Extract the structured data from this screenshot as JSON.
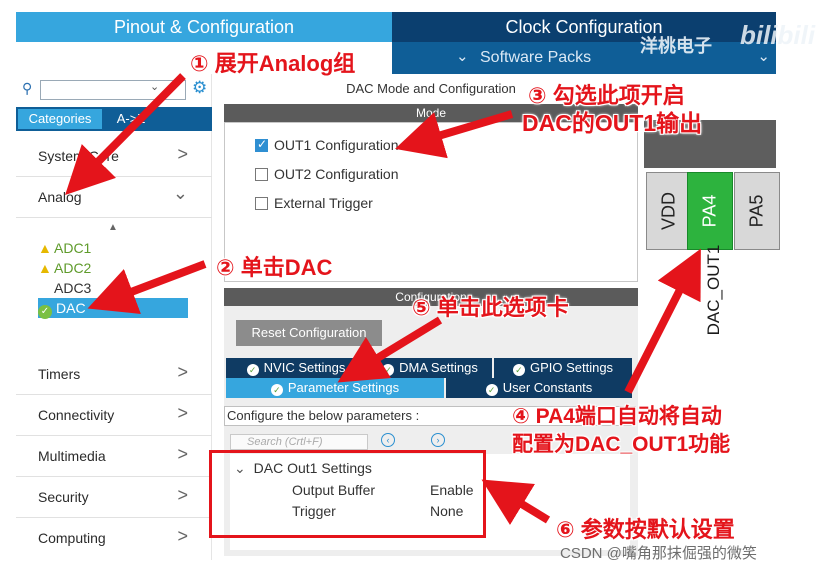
{
  "header": {
    "tab_pinout": "Pinout & Configuration",
    "tab_clock": "Clock Configuration",
    "software_packs": "Software Packs",
    "chevron_left": "⌄",
    "chevron_right": "⌄",
    "watermark_cn": "洋桃电子",
    "watermark_logo": "bilibili"
  },
  "left": {
    "search_placeholder": "",
    "tabs": {
      "categories": "Categories",
      "az": "A->Z"
    },
    "categories": [
      {
        "label": "System Core",
        "chevron": ">"
      },
      {
        "label": "Analog",
        "chevron": "⌄"
      },
      {
        "label": "Timers",
        "chevron": ">"
      },
      {
        "label": "Connectivity",
        "chevron": ">"
      },
      {
        "label": "Multimedia",
        "chevron": ">"
      },
      {
        "label": "Security",
        "chevron": ">"
      },
      {
        "label": "Computing",
        "chevron": ">"
      }
    ],
    "analog_items": [
      {
        "label": "ADC1",
        "status": "warning"
      },
      {
        "label": "ADC2",
        "status": "warning"
      },
      {
        "label": "ADC3",
        "status": "none"
      },
      {
        "label": "DAC",
        "status": "selected-ok"
      }
    ]
  },
  "mode": {
    "title": "DAC Mode and Configuration",
    "bar": "Mode",
    "options": [
      {
        "label": "OUT1 Configuration",
        "checked": true
      },
      {
        "label": "OUT2 Configuration",
        "checked": false
      },
      {
        "label": "External Trigger",
        "checked": false
      }
    ]
  },
  "config": {
    "bar": "Configuration",
    "reset_label": "Reset Configuration",
    "tabs": {
      "nvic": "NVIC Settings",
      "dma": "DMA Settings",
      "gpio": "GPIO Settings",
      "param": "Parameter Settings",
      "user": "User Constants"
    },
    "configure_line": "Configure the below parameters :",
    "search_placeholder": "Search (Crtl+F)",
    "group": "DAC Out1 Settings",
    "params": [
      {
        "name": "Output Buffer",
        "value": "Enable"
      },
      {
        "name": "Trigger",
        "value": "None"
      }
    ]
  },
  "chip": {
    "pins": [
      "VDD",
      "PA4",
      "PA5"
    ],
    "label": "DAC_OUT1"
  },
  "annotations": {
    "a1": "① 展开Analog组",
    "a2": "② 单击DAC",
    "a3_line1": "③ 勾选此项开启",
    "a3_line2": "DAC的OUT1输出",
    "a4_line1": "④ PA4端口自动将自动",
    "a4_line2": "配置为DAC_OUT1功能",
    "a5": "⑤ 单击此选项卡",
    "a6": "⑥ 参数按默认设置"
  },
  "footer": {
    "credit": "CSDN @嘴角那抹倔强的微笑"
  },
  "colors": {
    "annotation": "#e4141b",
    "header_blue": "#36a6de",
    "header_dark": "#0b3f6f",
    "pin_active": "#2db33e"
  },
  "icons": [
    "search-icon",
    "gear-icon",
    "warning-icon",
    "check-circle-icon",
    "checkbox-icon",
    "chevron-right-icon",
    "chevron-down-icon",
    "arrow-icon"
  ]
}
